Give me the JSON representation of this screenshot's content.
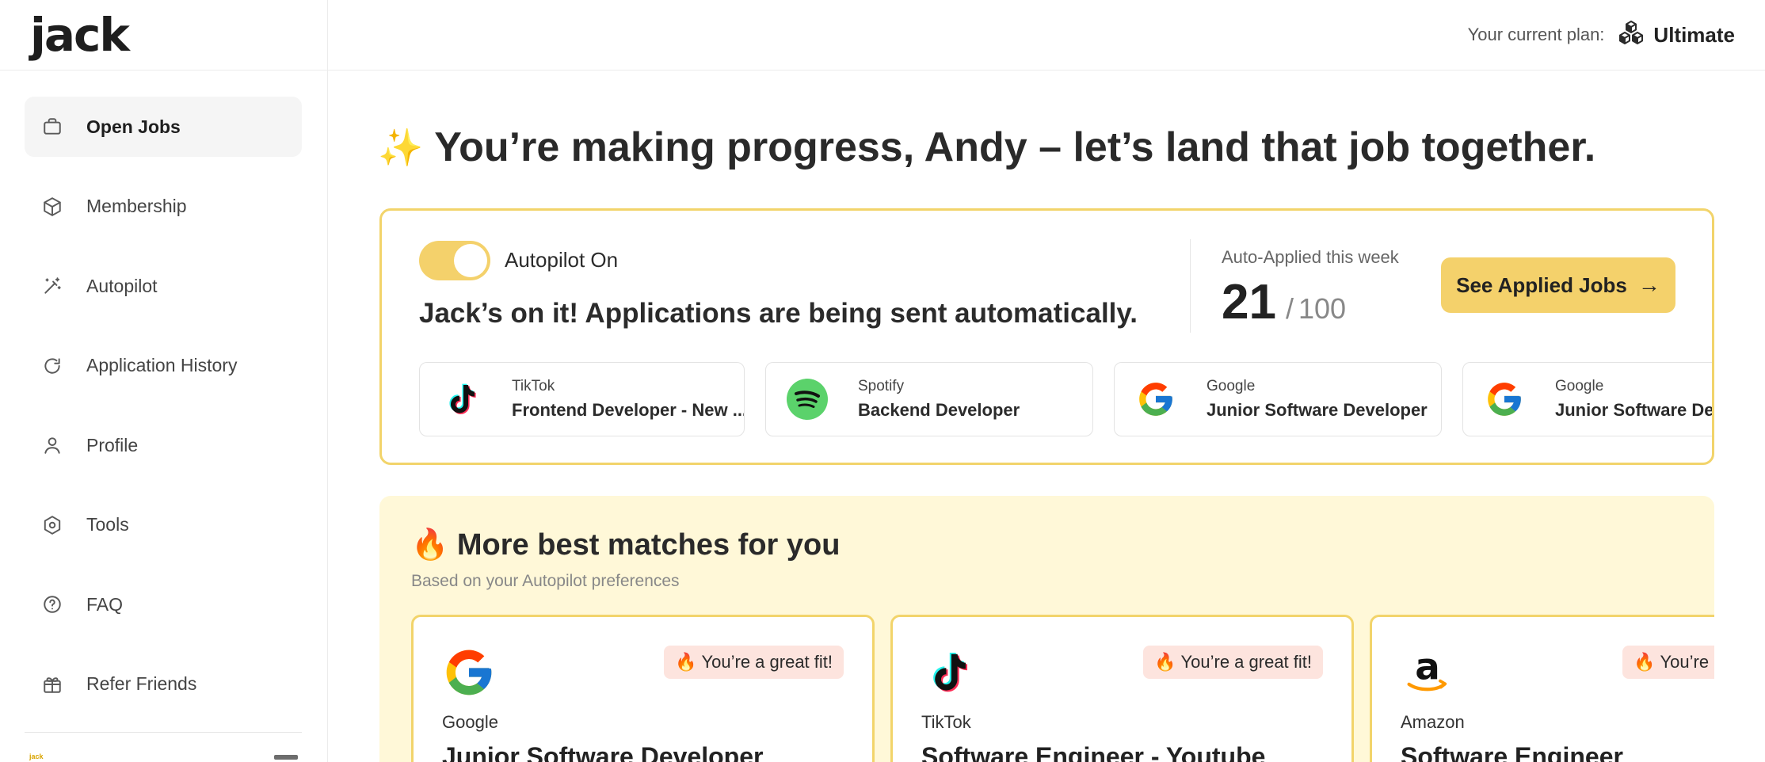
{
  "app": {
    "logo": "jack"
  },
  "sidebar": {
    "items": [
      {
        "label": "Open Jobs",
        "icon": "briefcase-icon",
        "active": true
      },
      {
        "label": "Membership",
        "icon": "box-icon"
      },
      {
        "label": "Autopilot",
        "icon": "magic-wand-icon"
      },
      {
        "label": "Application History",
        "icon": "refresh-icon"
      },
      {
        "label": "Profile",
        "icon": "user-icon"
      },
      {
        "label": "Tools",
        "icon": "hexagon-gear-icon"
      },
      {
        "label": "FAQ",
        "icon": "help-circle-icon"
      },
      {
        "label": "Refer Friends",
        "icon": "gift-icon"
      }
    ],
    "mini_logo": "jack"
  },
  "header": {
    "plan_label": "Your current plan:",
    "plan_value": "Ultimate",
    "plan_icon": "cubes-icon"
  },
  "main": {
    "greeting_emoji": "✨",
    "greeting": "You’re making progress, Andy – let’s land that job together.",
    "autopilot": {
      "toggle_label": "Autopilot On",
      "toggle_on": true,
      "message": "Jack’s on it! Applications are being sent automatically.",
      "stat_label": "Auto-Applied this week",
      "stat_value": "21",
      "stat_separator": "/",
      "stat_total": "100",
      "button_label": "See Applied Jobs",
      "button_arrow": "→",
      "jobs": [
        {
          "company": "TikTok",
          "title": "Frontend Developer - New ...",
          "logo": "tiktok-logo-icon"
        },
        {
          "company": "Spotify",
          "title": "Backend Developer",
          "logo": "spotify-logo-icon"
        },
        {
          "company": "Google",
          "title": "Junior Software Developer",
          "logo": "google-logo-icon"
        },
        {
          "company": "Google",
          "title": "Junior Software Developer",
          "logo": "google-logo-icon"
        }
      ]
    },
    "matches": {
      "title_emoji": "🔥",
      "title": "More best matches for you",
      "subtitle": "Based on your Autopilot preferences",
      "cards": [
        {
          "company": "Google",
          "title": "Junior Software Developer",
          "badge": "🔥 You’re a great fit!",
          "logo": "google-logo-icon"
        },
        {
          "company": "TikTok",
          "title": "Software Engineer - Youtube",
          "badge": "🔥 You’re a great fit!",
          "logo": "tiktok-logo-icon"
        },
        {
          "company": "Amazon",
          "title": "Software Engineer",
          "badge": "🔥 You’re a great fit!",
          "logo": "amazon-logo-icon"
        }
      ]
    }
  },
  "colors": {
    "accent": "#f4d16b",
    "accent_border": "#f2d46b",
    "section_bg": "#fff8d8",
    "badge_bg": "#fde4de"
  }
}
